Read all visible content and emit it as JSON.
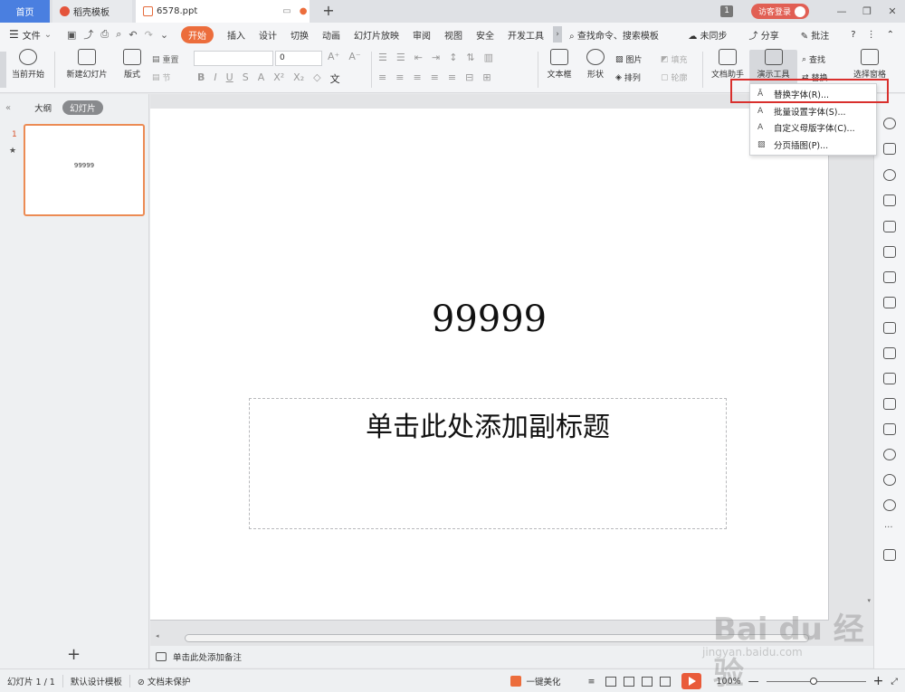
{
  "titlebar": {
    "tab_home": "首页",
    "tab_templates": "稻壳模板",
    "tab_file": "6578.ppt",
    "window_count": "1",
    "guest_login": "访客登录",
    "accent": "#4a7fe0"
  },
  "menubar": {
    "file": "文件",
    "items": [
      "开始",
      "插入",
      "设计",
      "切换",
      "动画",
      "幻灯片放映",
      "审阅",
      "视图",
      "安全",
      "开发工具"
    ],
    "active_item": "开始",
    "search": "查找命令、搜索模板",
    "unsynced": "未同步",
    "share": "分享",
    "annotate": "批注"
  },
  "ribbon": {
    "from_current": "当前开始",
    "new_slide": "新建幻灯片",
    "layout": "版式",
    "reset": "重置",
    "section": "节",
    "font_size": "0",
    "textbox": "文本框",
    "shape": "形状",
    "picture": "图片",
    "arrange": "排列",
    "fill": "填充",
    "outline": "轮廓",
    "doc_assistant": "文档助手",
    "presentation_tools": "演示工具",
    "find": "查找",
    "replace": "替换",
    "select_pane": "选择窗格"
  },
  "dropdown": {
    "items": [
      "替换字体(R)...",
      "批量设置字体(S)...",
      "自定义母版字体(C)...",
      "分页插图(P)..."
    ]
  },
  "left_panel": {
    "tab_outline": "大纲",
    "tab_slides": "幻灯片",
    "slide_number": "1",
    "thumb_text": "99999"
  },
  "slide": {
    "title": "99999",
    "subtitle": "单击此处添加副标题"
  },
  "notes": {
    "placeholder": "单击此处添加备注"
  },
  "statusbar": {
    "slide_info": "幻灯片 1 / 1",
    "template": "默认设计模板",
    "protection": "文档未保护",
    "beautify": "一键美化",
    "zoom": "100%"
  },
  "watermark": {
    "brand": "Bai du 经验",
    "url": "jingyan.baidu.com"
  }
}
